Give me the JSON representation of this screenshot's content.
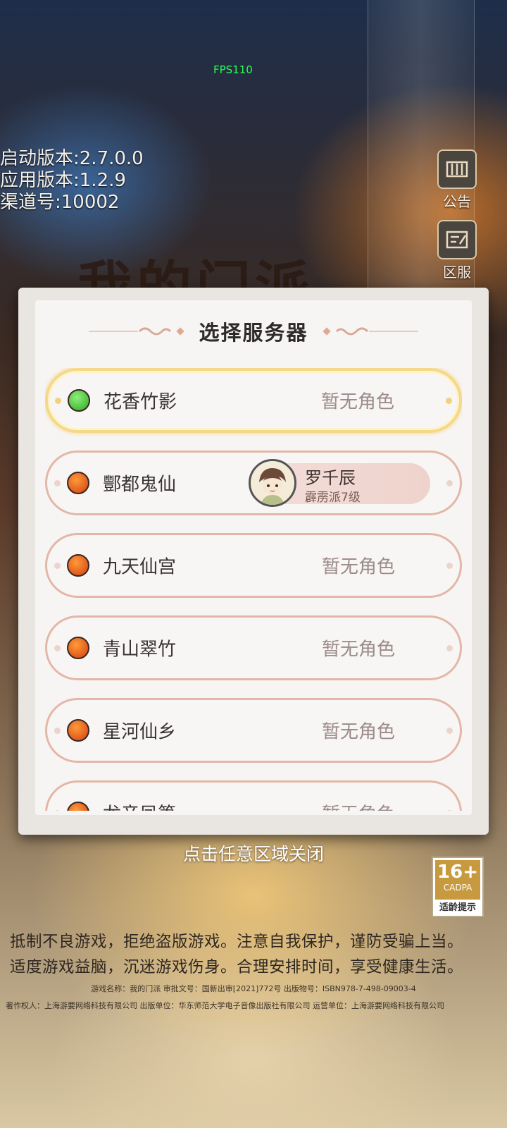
{
  "overlay": {
    "fps": "FPS110",
    "version_lines": [
      "启动版本:2.7.0.0",
      "应用版本:1.2.9",
      "渠道号:10002"
    ],
    "bg_title": "我的门派"
  },
  "side_buttons": [
    {
      "label": "公告",
      "icon": "announcement-icon"
    },
    {
      "label": "区服",
      "icon": "server-icon"
    }
  ],
  "dialog": {
    "title": "选择服务器",
    "servers": [
      {
        "name": "花香竹影",
        "status": "暂无角色",
        "dot_color": "#3fbf2f",
        "selected": true
      },
      {
        "name": "酆都鬼仙",
        "status": "",
        "dot_color": "#e2561b",
        "selected": false,
        "role": {
          "name": "罗千辰",
          "level": "霹雳派7级"
        }
      },
      {
        "name": "九天仙宫",
        "status": "暂无角色",
        "dot_color": "#e2561b",
        "selected": false
      },
      {
        "name": "青山翠竹",
        "status": "暂无角色",
        "dot_color": "#e2561b",
        "selected": false
      },
      {
        "name": "星河仙乡",
        "status": "暂无角色",
        "dot_color": "#e2561b",
        "selected": false
      },
      {
        "name": "龙音凤箫",
        "status": "暂无角色",
        "dot_color": "#e2561b",
        "selected": false
      }
    ]
  },
  "close_hint": "点击任意区域关闭",
  "age_rating": {
    "age": "16+",
    "org": "CADPA",
    "tip": "适龄提示"
  },
  "notice": [
    "抵制不良游戏，拒绝盗版游戏。注意自我保护，谨防受骗上当。",
    "适度游戏益脑，沉迷游戏伤身。合理安排时间，享受健康生活。"
  ],
  "legal": {
    "line1": "游戏名称：我的门派 审批文号：国新出审[2021]772号 出版物号：ISBN978-7-498-09003-4",
    "line2": "著作权人：上海游要网络科技有限公司 出版单位：华东师范大学电子音像出版社有限公司 运营单位：上海游要网络科技有限公司"
  }
}
